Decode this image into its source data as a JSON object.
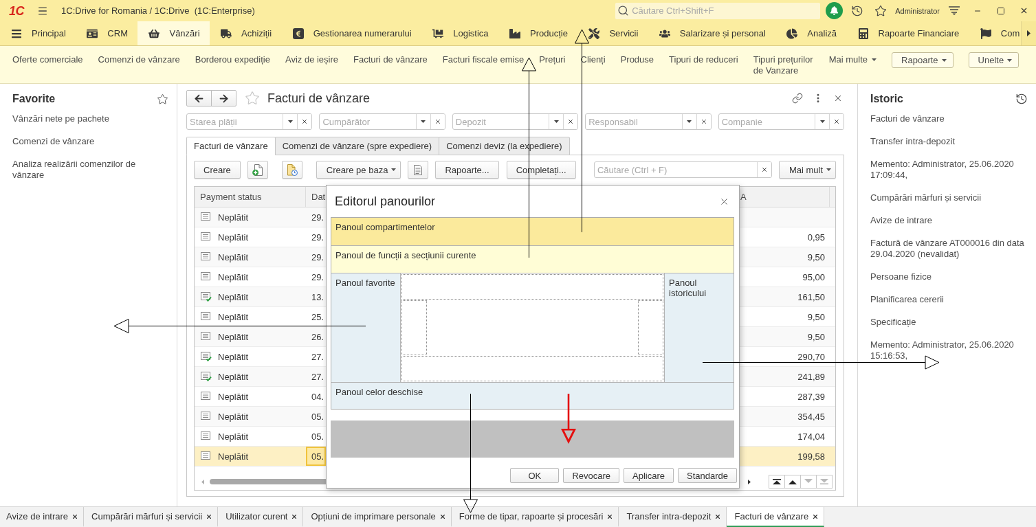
{
  "title_bar": {
    "logo": "1C",
    "title": "1C:Drive for Romania / 1C:Drive  (1C:Enterprise)",
    "search": {
      "placeholder": "Căutare Ctrl+Shift+F"
    },
    "user": "Administrator"
  },
  "sections": [
    {
      "label": "Principal",
      "selected": false
    },
    {
      "label": "CRM",
      "selected": false
    },
    {
      "label": "Vânzări",
      "selected": true
    },
    {
      "label": "Achiziții",
      "selected": false
    },
    {
      "label": "Gestionarea numerarului",
      "selected": false
    },
    {
      "label": "Logistica",
      "selected": false
    },
    {
      "label": "Producție",
      "selected": false
    },
    {
      "label": "Servicii",
      "selected": false
    },
    {
      "label": "Salarizare și personal",
      "selected": false
    },
    {
      "label": "Analiză",
      "selected": false
    },
    {
      "label": "Rapoarte Financiare",
      "selected": false
    },
    {
      "label": "Com",
      "selected": false
    }
  ],
  "function_panel": {
    "links": [
      "Oferte comerciale",
      "Comenzi de vânzare",
      "Borderou expediție",
      "Aviz de ieșire",
      "Facturi de vânzare",
      "Facturi fiscale emise",
      "Prețuri",
      "Clienți",
      "Produse",
      "Tipuri de reduceri",
      "Tipuri prețurilor de Vanzare"
    ],
    "more": "Mai multe",
    "menus": [
      "Rapoarte",
      "Unelte"
    ]
  },
  "favorites": {
    "title": "Favorite",
    "items": [
      "Vânzări nete pe pachete",
      "Comenzi de vânzare",
      "Analiza realizării comenzilor de vânzare"
    ]
  },
  "form": {
    "title": "Facturi de vânzare",
    "filters": [
      {
        "placeholder": "Starea plății"
      },
      {
        "placeholder": "Cumpărător"
      },
      {
        "placeholder": "Depozit"
      },
      {
        "placeholder": "Responsabil"
      },
      {
        "placeholder": "Companie"
      }
    ],
    "tabs": [
      {
        "label": "Facturi de vânzare",
        "selected": true
      },
      {
        "label": "Comenzi de vânzare (spre expediere)",
        "selected": false
      },
      {
        "label": "Comenzi deviz (la expediere)",
        "selected": false
      }
    ],
    "toolbar": {
      "create": "Creare",
      "create_based_on": "Creare pe baza",
      "reports": "Rapoarte...",
      "fill": "Completați...",
      "search": {
        "placeholder": "Căutare (Ctrl + F)"
      },
      "more": "Mai mult"
    },
    "table": {
      "columns": [
        "Payment status",
        "Dat",
        "A"
      ],
      "rows": [
        {
          "status": "Neplătit",
          "posted": false,
          "date": "29.",
          "selected": false
        },
        {
          "status": "Neplătit",
          "posted": false,
          "date": "29.",
          "amount": "0,95",
          "selected": false
        },
        {
          "status": "Neplătit",
          "posted": false,
          "date": "29.",
          "amount": "9,50",
          "selected": false
        },
        {
          "status": "Neplătit",
          "posted": false,
          "date": "29.",
          "amount": "95,00",
          "selected": false
        },
        {
          "status": "Neplătit",
          "posted": true,
          "date": "13.",
          "amount": "161,50",
          "selected": false
        },
        {
          "status": "Neplătit",
          "posted": false,
          "date": "25.",
          "amount": "9,50",
          "selected": false
        },
        {
          "status": "Neplătit",
          "posted": false,
          "date": "26.",
          "amount": "9,50",
          "selected": false
        },
        {
          "status": "Neplătit",
          "posted": true,
          "date": "27.",
          "amount": "290,70",
          "selected": false
        },
        {
          "status": "Neplătit",
          "posted": true,
          "date": "27.",
          "amount": "241,89",
          "selected": false
        },
        {
          "status": "Neplătit",
          "posted": false,
          "date": "04.",
          "amount": "287,39",
          "selected": false
        },
        {
          "status": "Neplătit",
          "posted": false,
          "date": "05.",
          "amount": "354,45",
          "selected": false
        },
        {
          "status": "Neplătit",
          "posted": false,
          "date": "05.",
          "amount": "174,04",
          "selected": false
        },
        {
          "status": "Neplătit",
          "posted": false,
          "date": "05.",
          "amount": "199,58",
          "selected": true
        }
      ],
      "navigation": [
        {
          "disabled": false
        },
        {
          "disabled": false
        },
        {
          "disabled": true
        },
        {
          "disabled": true
        }
      ]
    }
  },
  "dialog": {
    "title": "Editorul panourilor",
    "top_panels": [
      "Panoul compartimentelor",
      "Panoul de funcții a secțiunii curente"
    ],
    "left_panel": "Panoul favorite",
    "right_panel": "Panoul istoricului",
    "bottom_panel": "Panoul celor deschise",
    "buttons": [
      "OK",
      "Revocare",
      "Aplicare",
      "Standarde"
    ]
  },
  "history": {
    "title": "Istoric",
    "items": [
      "Facturi de vânzare",
      "Transfer intra-depozit",
      "Memento: Administrator, 25.06.2020 17:09:44,",
      "Cumpărări mărfuri și servicii",
      "Avize de intrare",
      "Factură de vânzare AT000016 din data 29.04.2020 (nevalidat)",
      "Persoane fizice",
      "Planificarea cererii",
      "Specificație",
      "Memento: Administrator, 25.06.2020 15:16:53,"
    ]
  },
  "open_windows": [
    {
      "label": "Avize de intrare",
      "selected": false
    },
    {
      "label": "Cumpărări mărfuri și servicii",
      "selected": false
    },
    {
      "label": "Utilizator curent",
      "selected": false
    },
    {
      "label": "Opțiuni de imprimare personale",
      "selected": false
    },
    {
      "label": "Forme de tipar, rapoarte și procesări",
      "selected": false
    },
    {
      "label": "Transfer intra-depozit",
      "selected": false
    },
    {
      "label": "Facturi de vânzare",
      "selected": true
    }
  ]
}
